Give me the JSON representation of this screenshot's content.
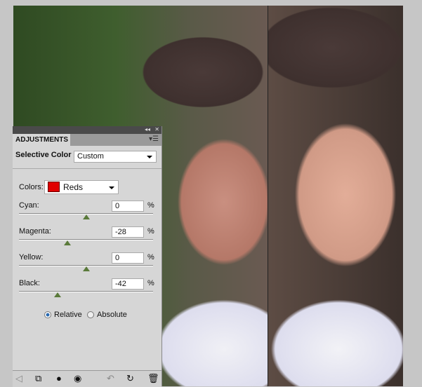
{
  "panel": {
    "collapse_icon": "double-chevron-left-icon",
    "close_icon": "close-icon",
    "tab_label": "ADJUSTMENTS",
    "menu_icon": "panel-menu-icon",
    "adjustment_name": "Selective Color",
    "preset_value": "Custom",
    "colors_label": "Colors:",
    "colors_value": "Reds",
    "colors_swatch": "#e00000",
    "sliders": [
      {
        "label": "Cyan:",
        "value": "0",
        "unit": "%",
        "level": 0
      },
      {
        "label": "Magenta:",
        "value": "-28",
        "unit": "%",
        "level": -28
      },
      {
        "label": "Yellow:",
        "value": "0",
        "unit": "%",
        "level": 0
      },
      {
        "label": "Black:",
        "value": "-42",
        "unit": "%",
        "level": -42
      }
    ],
    "method": {
      "relative": "Relative",
      "absolute": "Absolute",
      "selected": "relative"
    },
    "slider_range": [
      -100,
      100
    ]
  }
}
